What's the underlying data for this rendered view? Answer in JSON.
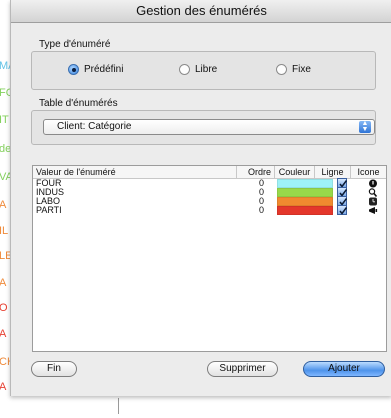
{
  "window": {
    "title": "Gestion des énumérés"
  },
  "background": {
    "clipped_labels": [
      {
        "text": "MA",
        "color": "#63c3e6"
      },
      {
        "text": "FO",
        "color": "#85d15f"
      },
      {
        "text": "IT",
        "color": "#85d15f"
      },
      {
        "text": "de",
        "color": "#85d15f"
      },
      {
        "text": "VA",
        "color": "#85d15f"
      },
      {
        "text": "A",
        "color": "#ef8a3a"
      },
      {
        "text": "IL",
        "color": "#ef8a3a"
      },
      {
        "text": "LE",
        "color": "#ef8a3a"
      },
      {
        "text": "A",
        "color": "#ef8a3a"
      },
      {
        "text": "O",
        "color": "#e74032"
      },
      {
        "text": "A",
        "color": "#e74032"
      },
      {
        "text": "CH",
        "color": "#ef8a3a"
      },
      {
        "text": "A",
        "color": "#e74032"
      }
    ]
  },
  "type_group": {
    "label": "Type d'énuméré",
    "options": [
      {
        "label": "Prédéfini",
        "checked": true
      },
      {
        "label": "Libre",
        "checked": false
      },
      {
        "label": "Fixe",
        "checked": false
      }
    ]
  },
  "table_group": {
    "label": "Table d'énumérés",
    "selected": "Client: Catégorie"
  },
  "grid": {
    "headers": {
      "value": "Valeur de l'énuméré",
      "order": "Ordre",
      "color": "Couleur",
      "line": "Ligne",
      "icon": "Icone"
    },
    "rows": [
      {
        "value": "FOUR",
        "order": "0",
        "color": "#9ef2f7",
        "line": true,
        "icon": "circle-info-icon"
      },
      {
        "value": "INDUS",
        "order": "0",
        "color": "#98d94a",
        "line": true,
        "icon": "magnifier-icon"
      },
      {
        "value": "LABO",
        "order": "0",
        "color": "#f08a2f",
        "line": true,
        "icon": "clock-icon"
      },
      {
        "value": "PARTI",
        "order": "0",
        "color": "#e4372b",
        "line": true,
        "icon": "megaphone-icon"
      }
    ]
  },
  "buttons": {
    "fin": "Fin",
    "supprimer": "Supprimer",
    "ajouter": "Ajouter"
  }
}
